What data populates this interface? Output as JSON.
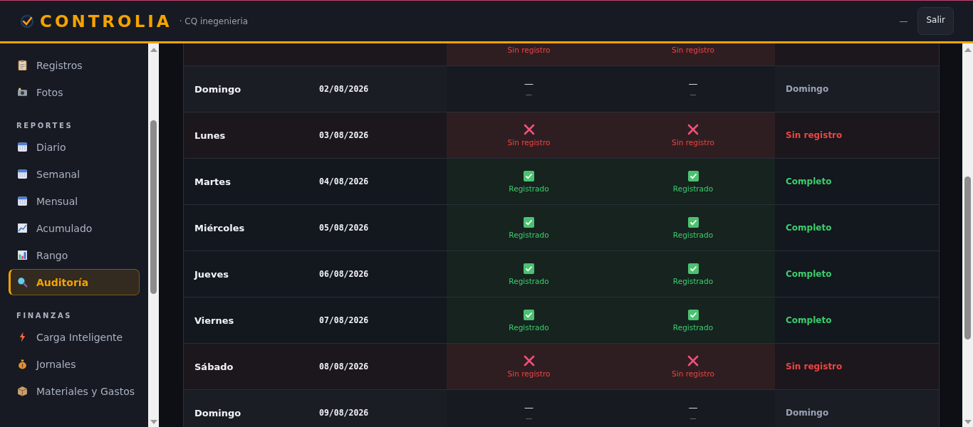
{
  "header": {
    "brand": "CONTROLIA",
    "subtitle": "· CQ inegenieria",
    "minimize": "—",
    "logout": "Salir"
  },
  "sidebar": {
    "sections": [
      {
        "items": [
          {
            "label": "Registros",
            "selected": false
          },
          {
            "label": "Fotos",
            "selected": false
          }
        ]
      },
      {
        "title": "REPORTES",
        "items": [
          {
            "label": "Diario",
            "selected": false
          },
          {
            "label": "Semanal",
            "selected": false
          },
          {
            "label": "Mensual",
            "selected": false
          },
          {
            "label": "Acumulado",
            "selected": false
          },
          {
            "label": "Rango",
            "selected": false
          },
          {
            "label": "Auditoría",
            "selected": true
          }
        ]
      },
      {
        "title": "FINANZAS",
        "items": [
          {
            "label": "Carga Inteligente",
            "selected": false
          },
          {
            "label": "Jornales",
            "selected": false
          },
          {
            "label": "Materiales y Gastos",
            "selected": false
          }
        ]
      }
    ]
  },
  "table": {
    "rows": [
      {
        "entries": [
          {
            "kind": "missing",
            "label": "Sin registro"
          },
          {
            "kind": "missing",
            "label": "Sin registro"
          }
        ],
        "status": {
          "kind": "missing"
        }
      },
      {
        "day": "Domingo",
        "date": "02/08/2026",
        "entries": [
          {
            "kind": "none",
            "label": "—",
            "sub": "—"
          },
          {
            "kind": "none",
            "label": "—",
            "sub": "—"
          }
        ],
        "status": {
          "kind": "none",
          "text": "Domingo"
        }
      },
      {
        "day": "Lunes",
        "date": "03/08/2026",
        "entries": [
          {
            "kind": "missing",
            "label": "Sin registro"
          },
          {
            "kind": "missing",
            "label": "Sin registro"
          }
        ],
        "status": {
          "kind": "missing",
          "text": "Sin registro"
        }
      },
      {
        "day": "Martes",
        "date": "04/08/2026",
        "entries": [
          {
            "kind": "ok",
            "label": "Registrado"
          },
          {
            "kind": "ok",
            "label": "Registrado"
          }
        ],
        "status": {
          "kind": "ok",
          "text": "Completo"
        }
      },
      {
        "day": "Miércoles",
        "date": "05/08/2026",
        "entries": [
          {
            "kind": "ok",
            "label": "Registrado"
          },
          {
            "kind": "ok",
            "label": "Registrado"
          }
        ],
        "status": {
          "kind": "ok",
          "text": "Completo"
        }
      },
      {
        "day": "Jueves",
        "date": "06/08/2026",
        "entries": [
          {
            "kind": "ok",
            "label": "Registrado"
          },
          {
            "kind": "ok",
            "label": "Registrado"
          }
        ],
        "status": {
          "kind": "ok",
          "text": "Completo"
        }
      },
      {
        "day": "Viernes",
        "date": "07/08/2026",
        "entries": [
          {
            "kind": "ok",
            "label": "Registrado"
          },
          {
            "kind": "ok",
            "label": "Registrado"
          }
        ],
        "status": {
          "kind": "ok",
          "text": "Completo"
        }
      },
      {
        "day": "Sábado",
        "date": "08/08/2026",
        "entries": [
          {
            "kind": "missing",
            "label": "Sin registro"
          },
          {
            "kind": "missing",
            "label": "Sin registro"
          }
        ],
        "status": {
          "kind": "missing",
          "text": "Sin registro"
        }
      },
      {
        "day": "Domingo",
        "date": "09/08/2026",
        "entries": [
          {
            "kind": "none",
            "label": "—",
            "sub": "—"
          },
          {
            "kind": "none",
            "label": "—",
            "sub": "—"
          }
        ],
        "status": {
          "kind": "none",
          "text": "Domingo"
        }
      }
    ]
  }
}
